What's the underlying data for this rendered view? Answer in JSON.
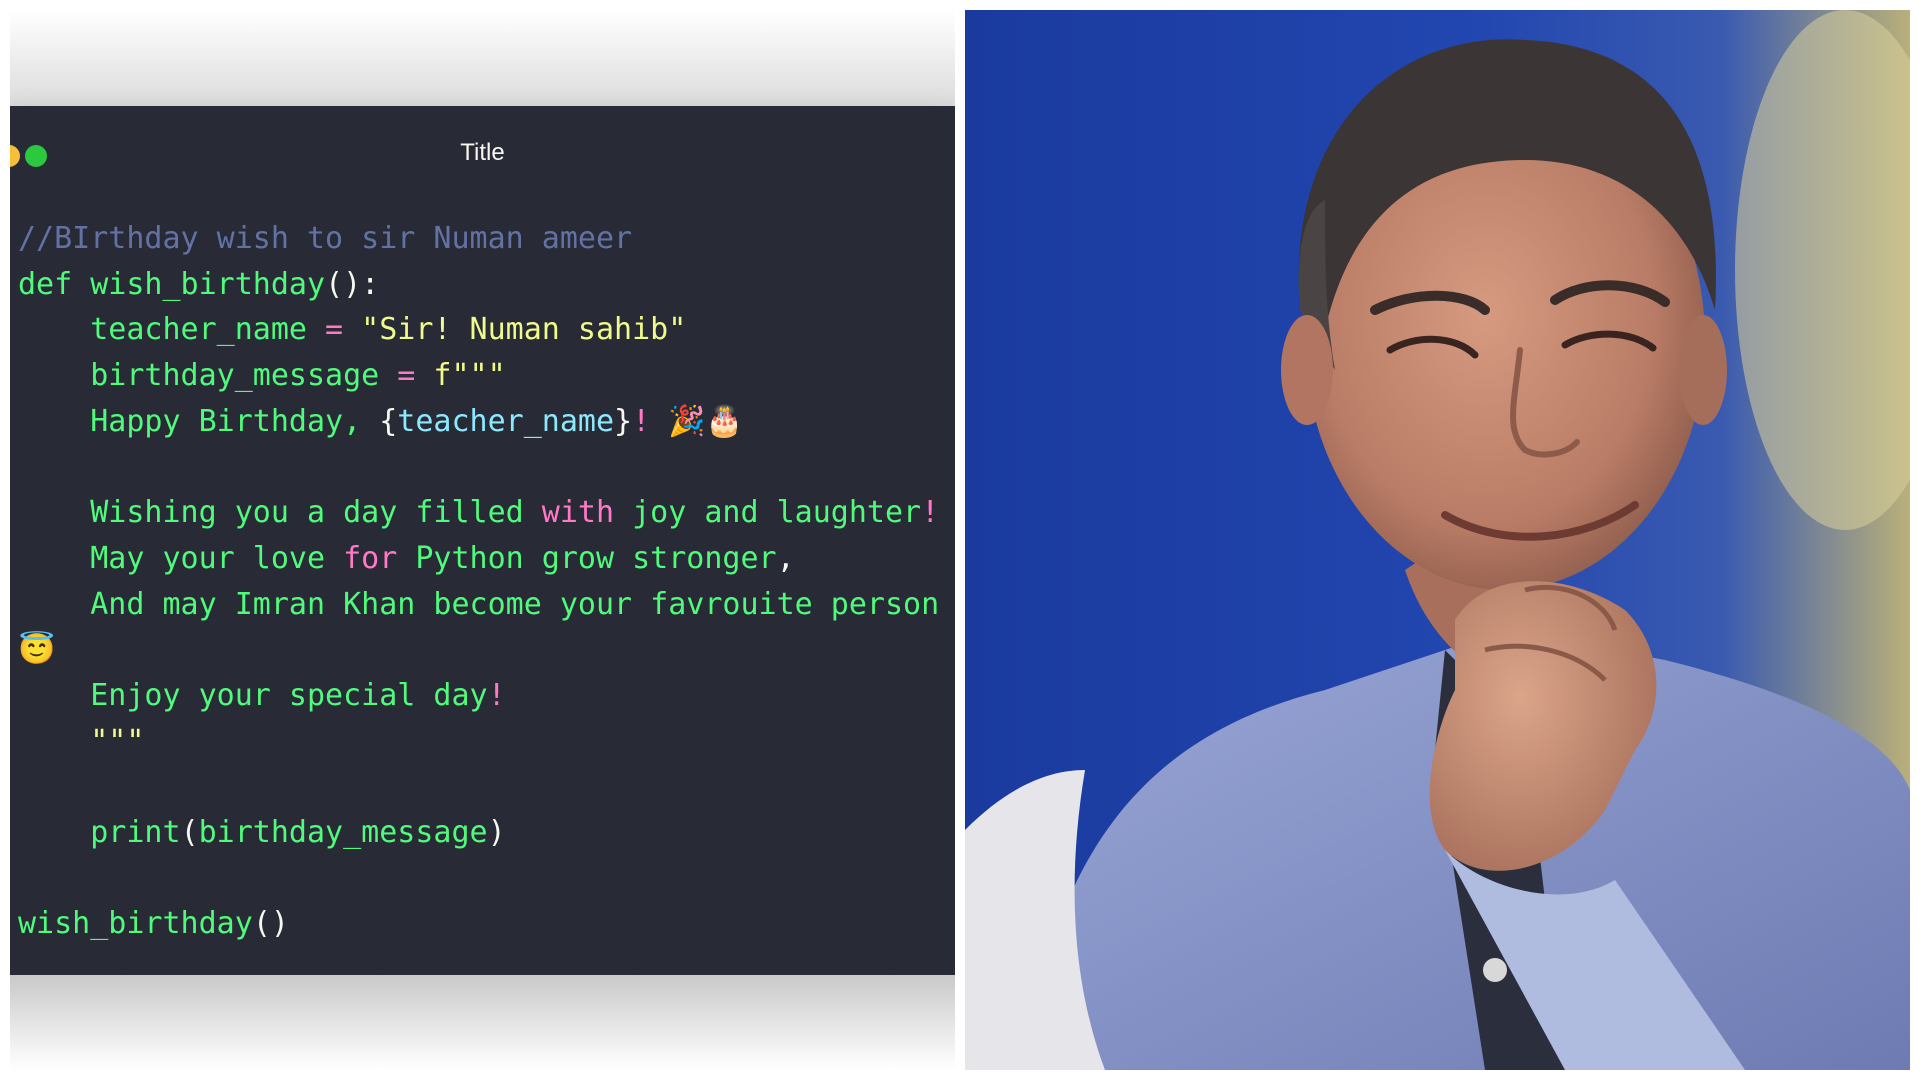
{
  "window": {
    "title": "Title"
  },
  "code_lines": [
    [
      {
        "t": "//BIrthday wish to sir Numan ameer",
        "c": "comment"
      }
    ],
    [
      {
        "t": "def ",
        "c": "green"
      },
      {
        "t": "wish_birthday",
        "c": "green"
      },
      {
        "t": "():",
        "c": "white"
      }
    ],
    [
      {
        "t": "    teacher_name ",
        "c": "green"
      },
      {
        "t": "= ",
        "c": "pink"
      },
      {
        "t": "\"Sir! Numan sahib\"",
        "c": "yellow"
      }
    ],
    [
      {
        "t": "    birthday_message ",
        "c": "green"
      },
      {
        "t": "= ",
        "c": "pink"
      },
      {
        "t": "f\"\"\"",
        "c": "yellow"
      }
    ],
    [
      {
        "t": "    Happy Birthday, ",
        "c": "green"
      },
      {
        "t": "{",
        "c": "white"
      },
      {
        "t": "teacher_name",
        "c": "cyan"
      },
      {
        "t": "}",
        "c": "white"
      },
      {
        "t": "! ",
        "c": "pink"
      },
      {
        "t": "🎉🎂",
        "c": "white"
      }
    ],
    [
      {
        "t": "",
        "c": "white"
      }
    ],
    [
      {
        "t": "    Wishing you a day filled ",
        "c": "green"
      },
      {
        "t": "with",
        "c": "pink"
      },
      {
        "t": " joy ",
        "c": "green"
      },
      {
        "t": "and",
        "c": "green"
      },
      {
        "t": " laughter",
        "c": "green"
      },
      {
        "t": "!",
        "c": "pink"
      }
    ],
    [
      {
        "t": "    May your love ",
        "c": "green"
      },
      {
        "t": "for",
        "c": "pink"
      },
      {
        "t": " Python grow stronger",
        "c": "green"
      },
      {
        "t": ",",
        "c": "white"
      }
    ],
    [
      {
        "t": "    And may Imran Khan become your favrouite person",
        "c": "green"
      }
    ],
    [
      {
        "t": "😇",
        "c": "white"
      }
    ],
    [
      {
        "t": "    Enjoy your special day",
        "c": "green"
      },
      {
        "t": "!",
        "c": "pink"
      }
    ],
    [
      {
        "t": "    \"\"\"",
        "c": "yellow"
      }
    ],
    [
      {
        "t": "",
        "c": "white"
      }
    ],
    [
      {
        "t": "    print",
        "c": "green"
      },
      {
        "t": "(",
        "c": "white"
      },
      {
        "t": "birthday_message",
        "c": "green"
      },
      {
        "t": ")",
        "c": "white"
      }
    ],
    [
      {
        "t": "",
        "c": "white"
      }
    ],
    [
      {
        "t": "wish_birthday",
        "c": "green"
      },
      {
        "t": "()",
        "c": "white"
      }
    ]
  ],
  "colors": {
    "editor_background": "#282a36",
    "comment": "#6272a4",
    "green": "#50fa7b",
    "yellow": "#f1fa8c",
    "pink": "#ff79c6",
    "cyan": "#8be9fd",
    "traffic_light_green": "#2bc840",
    "photo_background_blue": "#1d3fa4"
  },
  "photo": {
    "subject": "man-portrait-photo"
  }
}
